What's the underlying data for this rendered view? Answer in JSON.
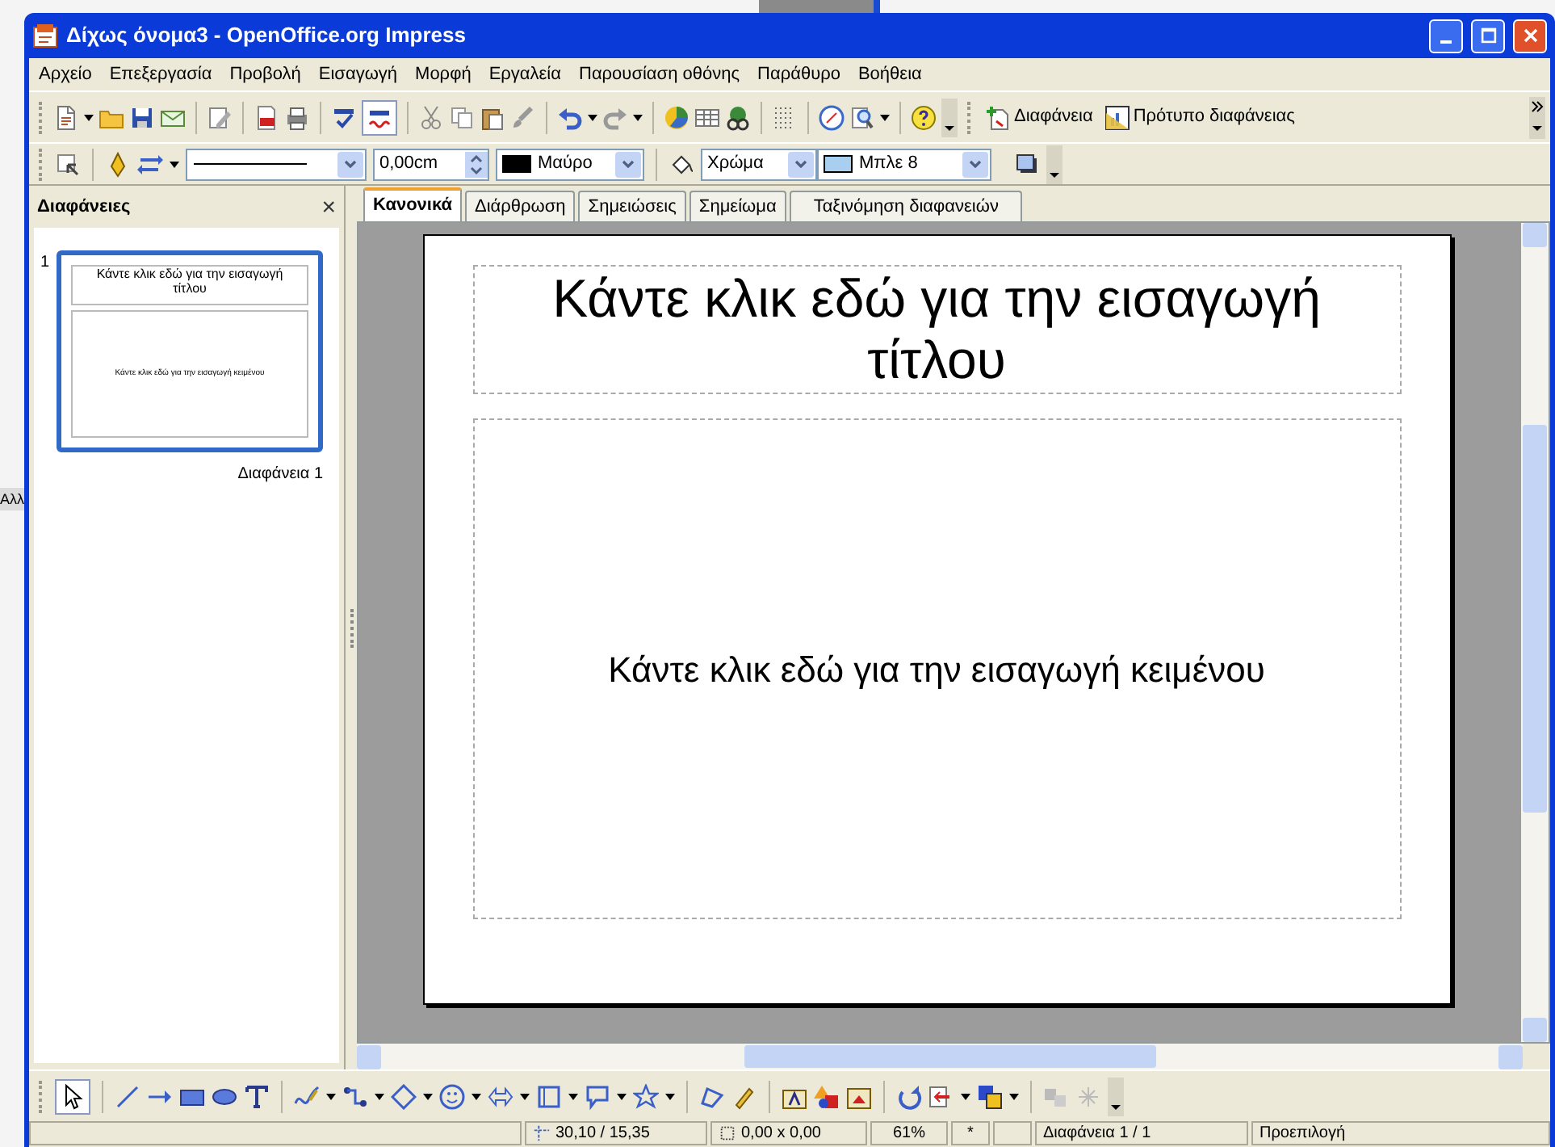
{
  "desktop": {
    "fragment": "Αλλ"
  },
  "window": {
    "title": "Δίχως όνομα3 - OpenOffice.org Impress"
  },
  "menu": [
    "Αρχείο",
    "Επεξεργασία",
    "Προβολή",
    "Εισαγωγή",
    "Μορφή",
    "Εργαλεία",
    "Παρουσίαση οθόνης",
    "Παράθυρο",
    "Βοήθεια"
  ],
  "toolbar": {
    "buttons": [
      "Διαφάνεια",
      "Πρότυπο διαφάνειας"
    ]
  },
  "format_toolbar": {
    "line_width": "0,00cm",
    "line_color": "Μαύρο",
    "area_style": "Χρώμα",
    "area_fill": "Μπλε 8"
  },
  "slides_pane": {
    "title": "Διαφάνειες",
    "close": "×",
    "slides": [
      {
        "number": "1",
        "thumb_title": "Κάντε κλικ εδώ για την εισαγωγή τίτλου",
        "thumb_body": "Κάντε κλικ εδώ για την εισαγωγή κειμένου",
        "name": "Διαφάνεια 1",
        "selected": true
      }
    ]
  },
  "tabs": [
    {
      "label": "Κανονικά",
      "selected": true
    },
    {
      "label": "Διάρθρωση",
      "selected": false
    },
    {
      "label": "Σημειώσεις",
      "selected": false
    },
    {
      "label": "Σημείωμα",
      "selected": false
    },
    {
      "label": "Ταξινόμηση διαφανειών",
      "selected": false
    }
  ],
  "slide": {
    "title": "Κάντε κλικ εδώ για την εισαγωγή τίτλου",
    "body": "Κάντε κλικ εδώ για την εισαγωγή κειμένου"
  },
  "status_bar": {
    "position": "30,10 / 15,35",
    "size": "0,00 x 0,00",
    "zoom": "61%",
    "modified": "*",
    "slide": "Διαφάνεια 1 / 1",
    "layout": "Προεπιλογή"
  }
}
